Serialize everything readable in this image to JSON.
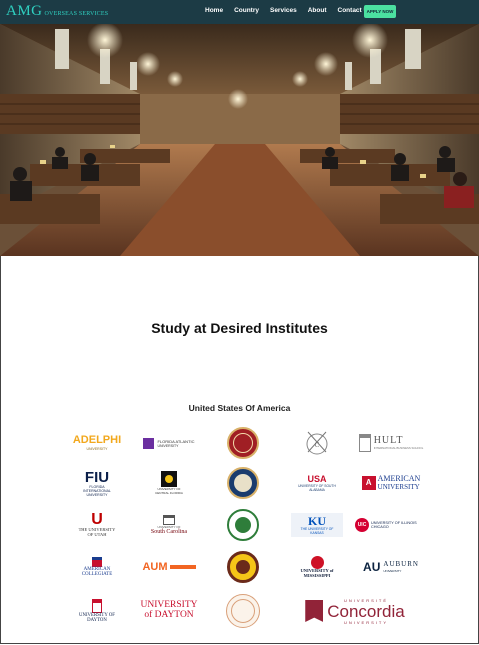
{
  "brand": {
    "main": "AMG",
    "sub": "OVERSEAS SERVICES"
  },
  "nav": {
    "links": [
      "Home",
      "Country",
      "Services",
      "About",
      "Contact Us"
    ],
    "apply_label": "APPLY NOW"
  },
  "section": {
    "title": "Study at Desired Institutes"
  },
  "country": {
    "title": "United States Of America"
  },
  "universities": {
    "adelphi": {
      "name": "ADELPHI",
      "sub": "UNIVERSITY"
    },
    "fau": {
      "name": "FLORIDA ATLANTIC",
      "sub": "UNIVERSITY"
    },
    "hult": {
      "name": "HULT",
      "sub": "INTERNATIONAL BUSINESS SCHOOL"
    },
    "fiu": {
      "name": "FIU",
      "sub": "FLORIDA INTERNATIONAL UNIVERSITY"
    },
    "ucf": {
      "name": "UCF",
      "sub": "UNIVERSITY OF CENTRAL FLORIDA"
    },
    "usa": {
      "name": "USA",
      "sub": "UNIVERSITY OF SOUTH ALABAMA"
    },
    "american": {
      "name": "AMERICAN",
      "sub": "UNIVERSITY"
    },
    "utah": {
      "name": "THE UNIVERSITY OF UTAH"
    },
    "sc": {
      "name": "South Carolina",
      "sub": "UNIVERSITY OF"
    },
    "ku": {
      "name": "KU",
      "sub": "THE UNIVERSITY OF KANSAS"
    },
    "uic": {
      "name": "UIC",
      "sub": "UNIVERSITY OF ILLINOIS CHICAGO"
    },
    "ac": {
      "name": "AMERICAN COLLEGIATE"
    },
    "aum": {
      "name": "AUM"
    },
    "miss": {
      "name": "UNIVERSITY of MISSISSIPPI"
    },
    "auburn": {
      "name": "AUBURN",
      "sub": "UNIVERSITY"
    },
    "dayton1": {
      "name": "UNIVERSITY OF DAYTON"
    },
    "dayton2": {
      "name": "UNIVERSITY of DAYTON"
    },
    "concordia": {
      "name": "Concordia",
      "top": "UNIVERSITÉ",
      "sub": "UNIVERSITY"
    }
  },
  "colors": {
    "nav_bg": "#1c3b45",
    "brand": "#2fd0c0",
    "apply_bg": "#4be0a0"
  }
}
